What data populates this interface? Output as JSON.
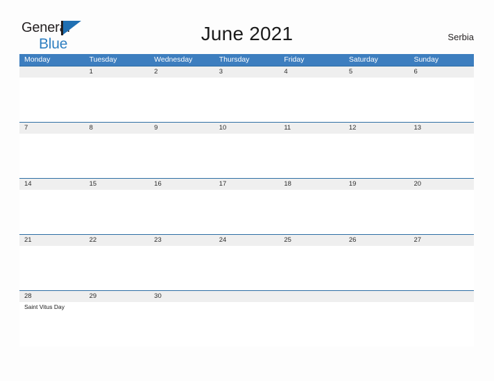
{
  "logo": {
    "word1": "General",
    "word2": "Blue",
    "flag_icon": "flag-triangle-icon",
    "color_word1": "#231f20",
    "color_word2": "#2e7fc1",
    "color_flag": "#1f6fb2"
  },
  "header": {
    "title": "June 2021",
    "country": "Serbia"
  },
  "colors": {
    "weekday_header_bg": "#3d7ebf",
    "weekday_header_text": "#ffffff",
    "date_row_bg": "#efefef",
    "row_rule": "#2b6ca3",
    "page_bg": "#fdfdfd"
  },
  "calendar": {
    "weekdays": [
      "Monday",
      "Tuesday",
      "Wednesday",
      "Thursday",
      "Friday",
      "Saturday",
      "Sunday"
    ],
    "weeks": [
      {
        "days": [
          {
            "num": "",
            "event": ""
          },
          {
            "num": "1",
            "event": ""
          },
          {
            "num": "2",
            "event": ""
          },
          {
            "num": "3",
            "event": ""
          },
          {
            "num": "4",
            "event": ""
          },
          {
            "num": "5",
            "event": ""
          },
          {
            "num": "6",
            "event": ""
          }
        ]
      },
      {
        "days": [
          {
            "num": "7",
            "event": ""
          },
          {
            "num": "8",
            "event": ""
          },
          {
            "num": "9",
            "event": ""
          },
          {
            "num": "10",
            "event": ""
          },
          {
            "num": "11",
            "event": ""
          },
          {
            "num": "12",
            "event": ""
          },
          {
            "num": "13",
            "event": ""
          }
        ]
      },
      {
        "days": [
          {
            "num": "14",
            "event": ""
          },
          {
            "num": "15",
            "event": ""
          },
          {
            "num": "16",
            "event": ""
          },
          {
            "num": "17",
            "event": ""
          },
          {
            "num": "18",
            "event": ""
          },
          {
            "num": "19",
            "event": ""
          },
          {
            "num": "20",
            "event": ""
          }
        ]
      },
      {
        "days": [
          {
            "num": "21",
            "event": ""
          },
          {
            "num": "22",
            "event": ""
          },
          {
            "num": "23",
            "event": ""
          },
          {
            "num": "24",
            "event": ""
          },
          {
            "num": "25",
            "event": ""
          },
          {
            "num": "26",
            "event": ""
          },
          {
            "num": "27",
            "event": ""
          }
        ]
      },
      {
        "days": [
          {
            "num": "28",
            "event": "Saint Vitus Day"
          },
          {
            "num": "29",
            "event": ""
          },
          {
            "num": "30",
            "event": ""
          },
          {
            "num": "",
            "event": ""
          },
          {
            "num": "",
            "event": ""
          },
          {
            "num": "",
            "event": ""
          },
          {
            "num": "",
            "event": ""
          }
        ]
      }
    ]
  }
}
